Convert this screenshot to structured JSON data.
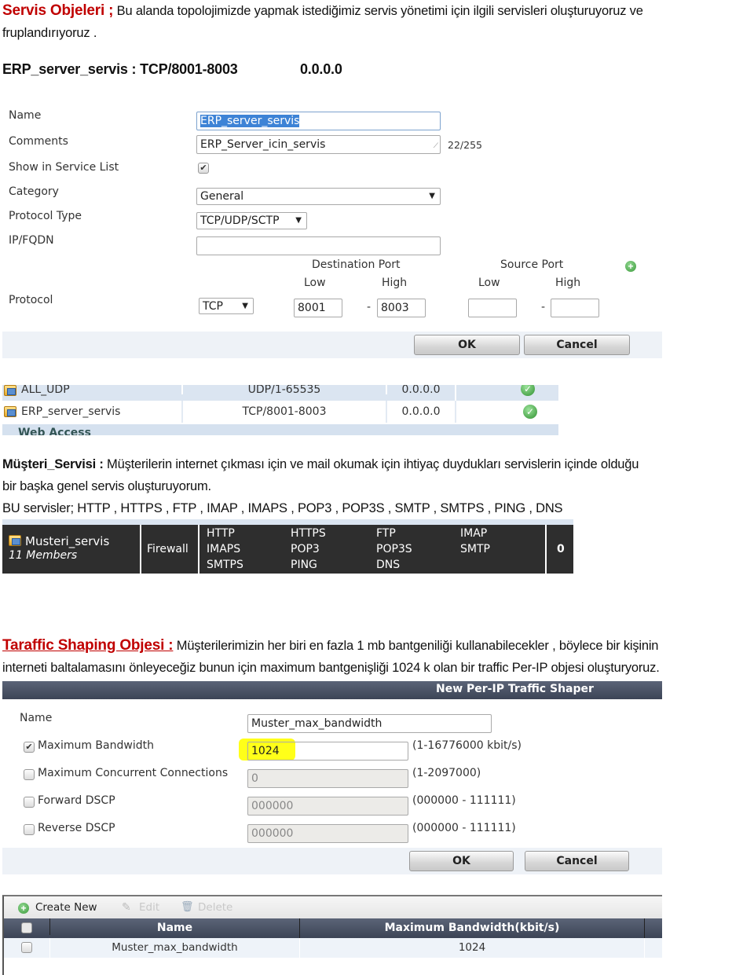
{
  "intro": {
    "title": "Servis   Objeleri ;",
    "text_line1": " Bu alanda topolojimizde yapmak istediğimiz servis yönetimi için ilgili servisleri oluşturuyoruz  ve",
    "text_line2": "fruplandırıyoruz .",
    "summary_name": "ERP_server_servis  : TCP/8001-8003",
    "summary_ip": "0.0.0.0"
  },
  "service_form": {
    "name_label": "Name",
    "name_value": "ERP_server_servis",
    "comments_label": "Comments",
    "comments_value": "ERP_Server_icin_servis",
    "comments_counter": "22/255",
    "show_in_list_label": "Show in Service List",
    "show_in_list_checked": true,
    "category_label": "Category",
    "category_value": "General",
    "protocol_type_label": "Protocol Type",
    "protocol_type_value": "TCP/UDP/SCTP",
    "ip_fqdn_label": "IP/FQDN",
    "ip_fqdn_value": "",
    "destination_port_label": "Destination Port",
    "source_port_label": "Source Port",
    "low_label": "Low",
    "high_label": "High",
    "protocol_label": "Protocol",
    "protocol_value": "TCP",
    "dest_low": "8001",
    "dest_high": "8003",
    "src_low": "",
    "src_high": "",
    "dash": "-",
    "ok_label": "OK",
    "cancel_label": "Cancel"
  },
  "service_list": {
    "rows": [
      {
        "name": "ALL_UDP",
        "ports": "UDP/1-65535",
        "ip": "0.0.0.0",
        "visible": true
      },
      {
        "name": "ERP_server_servis",
        "ports": "TCP/8001-8003",
        "ip": "0.0.0.0",
        "visible": true
      }
    ],
    "next_group": "Web Access"
  },
  "customer_service": {
    "title": "Müşteri_Servisi :",
    "bold_word": " Müşteriler",
    "text_line1": "in internet  çıkması  için   ve mail okumak için ihtiyaç duydukları servislerin  içinde olduğu",
    "text_line2": "bir başka genel servis oluşturuyorum.",
    "text_line3": "BU servisler; HTTP , HTTPS , FTP , IMAP , IMAPS  , POP3 , POP3S , SMTP , SMTPS , PING , DNS"
  },
  "service_group": {
    "name": "Musteri_servis",
    "members_count": "11 Members",
    "type": "Firewall",
    "members": [
      "HTTP",
      "HTTPS",
      "FTP",
      "IMAP",
      "IMAPS",
      "POP3",
      "POP3S",
      "SMTP",
      "SMTPS",
      "PING",
      "DNS"
    ],
    "ref": "0"
  },
  "traffic_shaping": {
    "title": "Taraffic Shaping Objesi :",
    "text_line1": "  Müşterilerimizin  her biri en fazla 1 mb bantgeniliği  kullanabilecekler , böylece bir kişinin",
    "text_line2": "interneti baltalamasını  önleyeceğiz bunun için maximum bantgenişliği 1024 k olan bir  traffic  Per-IP objesi oluşturyoruz."
  },
  "shaper_form": {
    "header": "New Per-IP Traffic Shaper",
    "name_label": "Name",
    "name_value": "Muster_max_bandwidth",
    "max_bw_label": "Maximum Bandwidth",
    "max_bw_checked": true,
    "max_bw_value": "1024",
    "max_bw_hint": "(1-16776000 kbit/s)",
    "max_conn_label": "Maximum Concurrent Connections",
    "max_conn_checked": false,
    "max_conn_value": "0",
    "max_conn_hint": "(1-2097000)",
    "fwd_dscp_label": "Forward DSCP",
    "fwd_dscp_checked": false,
    "fwd_dscp_value": "000000",
    "fwd_dscp_hint": "(000000 - 111111)",
    "rev_dscp_label": "Reverse DSCP",
    "rev_dscp_checked": false,
    "rev_dscp_value": "000000",
    "rev_dscp_hint": "(000000 - 111111)",
    "ok_label": "OK",
    "cancel_label": "Cancel",
    "highlight_color": "#ffff00"
  },
  "shaper_list": {
    "toolbar": {
      "create_new": "Create New",
      "edit": "Edit",
      "delete": "Delete"
    },
    "columns": [
      "Name",
      "Maximum Bandwidth(kbit/s)"
    ],
    "rows": [
      {
        "name": "Muster_max_bandwidth",
        "max_bandwidth": "1024"
      }
    ]
  }
}
